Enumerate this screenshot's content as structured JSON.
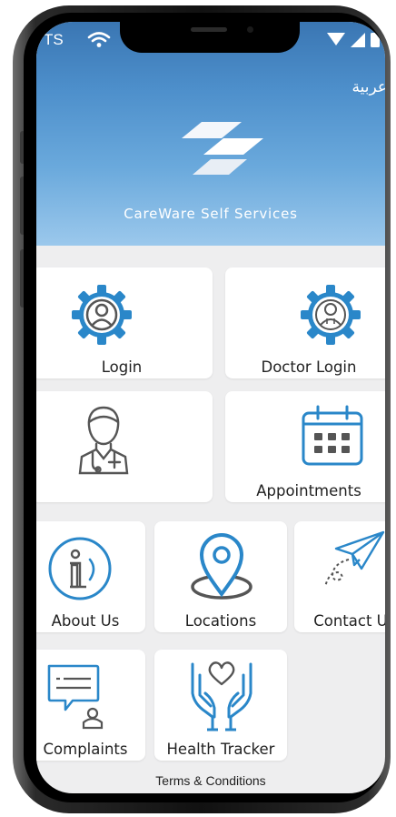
{
  "status": {
    "carrier": "TS",
    "icons": [
      "wifi-icon",
      "signal-icon",
      "battery-icon"
    ]
  },
  "header": {
    "language_toggle": "عربية",
    "app_name": "CareWare Self Services"
  },
  "tiles": {
    "login": {
      "label": "Login",
      "icon": "user-gear-icon"
    },
    "doctor_login": {
      "label": "Doctor Login",
      "icon": "doctor-gear-icon"
    },
    "doctor": {
      "label": "",
      "icon": "doctor-icon"
    },
    "appointments": {
      "label": "Appointments",
      "icon": "calendar-icon"
    },
    "about_us": {
      "label": "About Us",
      "icon": "info-icon"
    },
    "locations": {
      "label": "Locations",
      "icon": "location-pin-icon"
    },
    "contact_us": {
      "label": "Contact U",
      "icon": "paper-plane-icon"
    },
    "complaints": {
      "label": "Complaints",
      "icon": "complaint-chat-icon"
    },
    "health_tracker": {
      "label": "Health Tracker",
      "icon": "heart-hands-icon"
    }
  },
  "footer": {
    "terms": "Terms & Conditions"
  },
  "colors": {
    "accent": "#2a87c9",
    "header_top": "#3a76b3",
    "header_bottom": "#9bc8ec",
    "icon_dark": "#555555"
  }
}
